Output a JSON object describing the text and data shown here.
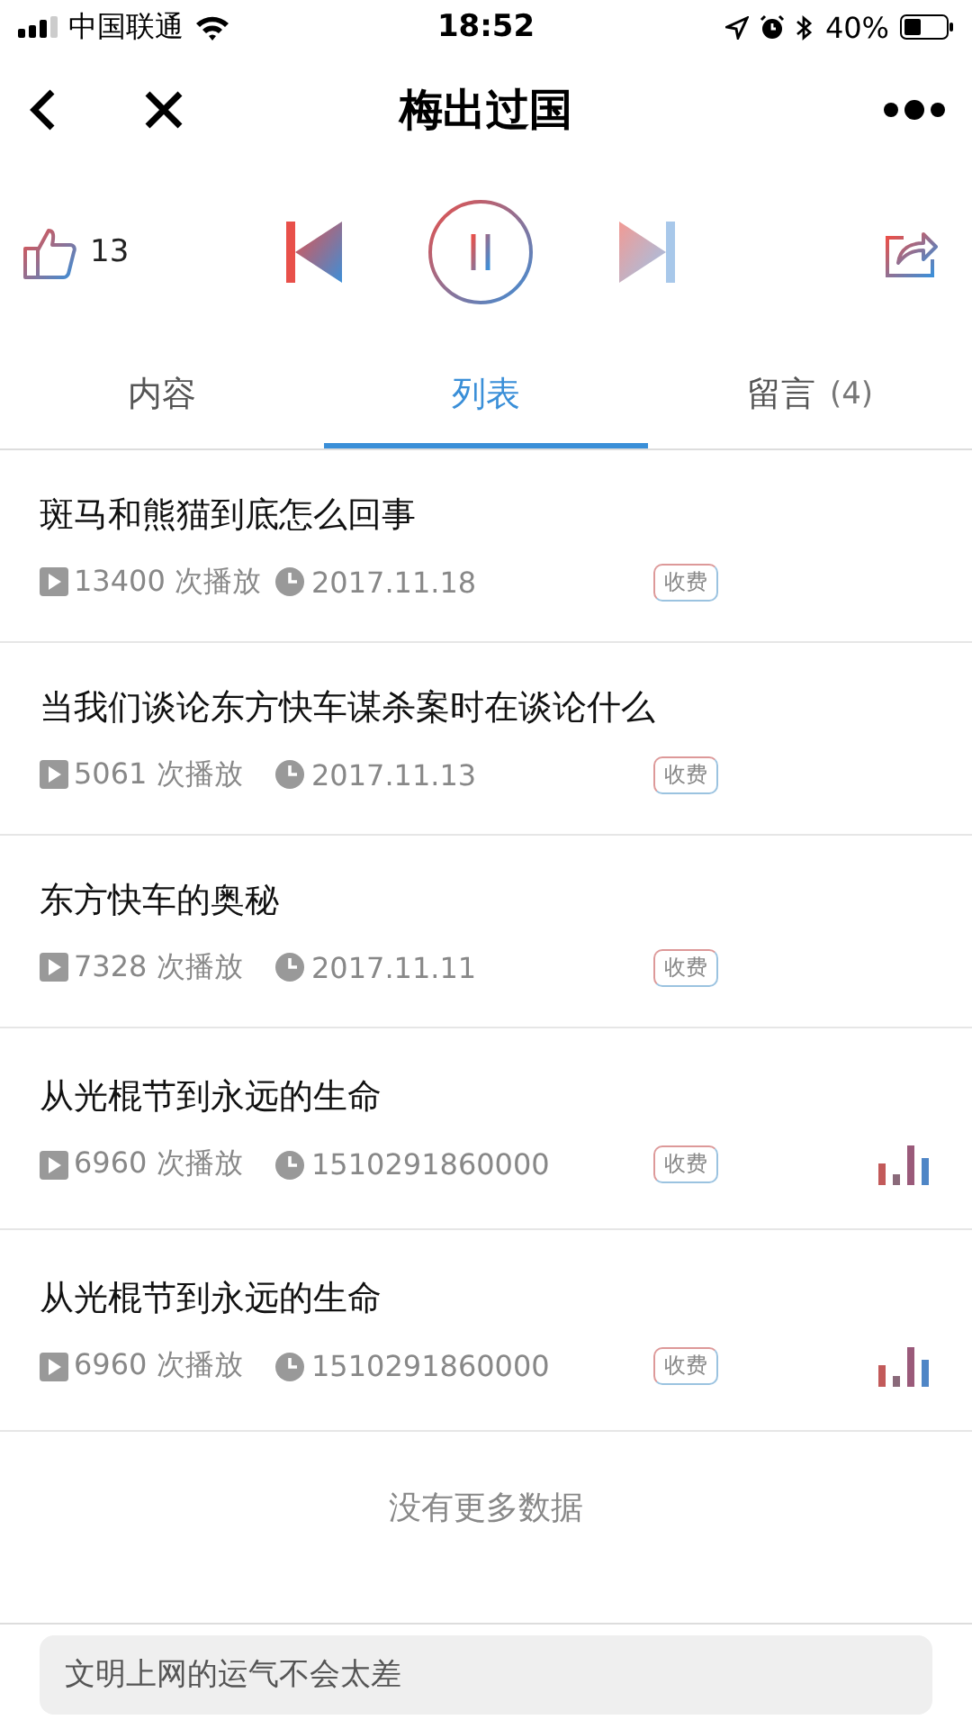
{
  "status_bar": {
    "carrier": "中国联通",
    "time": "18:52",
    "battery": "40%"
  },
  "nav": {
    "title": "梅出过国"
  },
  "player": {
    "likes": "13",
    "playing": true
  },
  "tabs": [
    {
      "label": "内容",
      "selected": false
    },
    {
      "label": "列表",
      "selected": true
    },
    {
      "label": "留言",
      "count": "(4)",
      "selected": false
    }
  ],
  "episodes": [
    {
      "title": "斑马和熊猫到底怎么回事",
      "plays": "13400 次播放",
      "date": "2017.11.18",
      "tag": "收费",
      "playing": false
    },
    {
      "title": "当我们谈论东方快车谋杀案时在谈论什么",
      "plays": "5061 次播放",
      "date": "2017.11.13",
      "tag": "收费",
      "playing": false
    },
    {
      "title": "东方快车的奥秘",
      "plays": "7328 次播放",
      "date": "2017.11.11",
      "tag": "收费",
      "playing": false
    },
    {
      "title": "从光棍节到永远的生命",
      "plays": "6960 次播放",
      "date": "1510291860000",
      "tag": "收费",
      "playing": true
    },
    {
      "title": "从光棍节到永远的生命",
      "plays": "6960 次播放",
      "date": "1510291860000",
      "tag": "收费",
      "playing": true
    }
  ],
  "end_note": "没有更多数据",
  "comment": {
    "placeholder": "文明上网的运气不会太差"
  }
}
